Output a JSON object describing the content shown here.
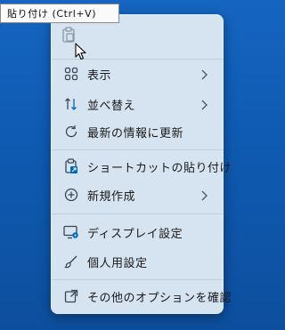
{
  "tooltip": {
    "text": "貼り付け (Ctrl+V)"
  },
  "menu": {
    "top_actions": [
      {
        "icon": "paste-icon"
      }
    ],
    "items": [
      {
        "label": "表示",
        "icon": "view-grid-icon",
        "submenu": true
      },
      {
        "label": "並べ替え",
        "icon": "sort-arrows-icon",
        "submenu": true
      },
      {
        "label": "最新の情報に更新",
        "icon": "refresh-icon",
        "submenu": false
      },
      {
        "label": "ショートカットの貼り付け",
        "icon": "paste-shortcut-icon",
        "submenu": false
      },
      {
        "label": "新規作成",
        "icon": "new-plus-icon",
        "submenu": true
      },
      {
        "label": "ディスプレイ設定",
        "icon": "display-settings-icon",
        "submenu": false
      },
      {
        "label": "個人用設定",
        "icon": "personalize-brush-icon",
        "submenu": false
      },
      {
        "label": "その他のオプションを確認",
        "icon": "more-options-icon",
        "submenu": false
      }
    ]
  },
  "colors": {
    "desktop": "#1565c0",
    "menu_background": "#d6e3f0",
    "icon": "#3a4654",
    "accent": "#0067c0"
  }
}
